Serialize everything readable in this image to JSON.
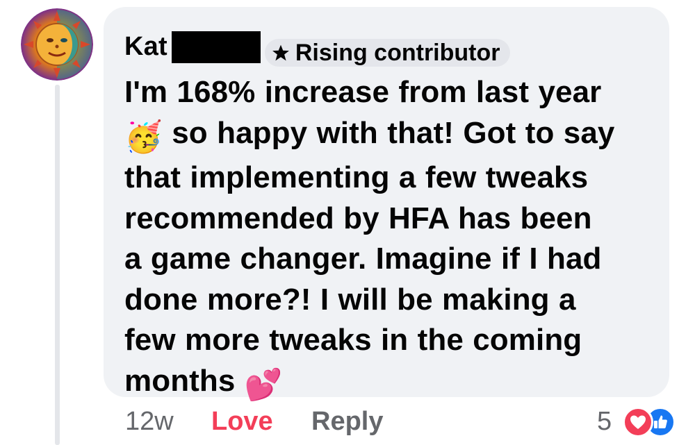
{
  "comment": {
    "author": "Kat",
    "author_redacted": true,
    "badge": {
      "label": "Rising contributor",
      "icon": "star-icon"
    },
    "lines": [
      "I'm 168% increase from last year",
      "so happy with that! Got to say",
      "that implementing a few tweaks",
      "recommended by HFA has been",
      "a game changer. Imagine if I had",
      "done more?! I will be making a",
      "few more tweaks in the coming",
      "months"
    ],
    "emojis": {
      "line2_prefix": "🥳",
      "line8_suffix": "💕"
    }
  },
  "footer": {
    "timestamp": "12w",
    "love_label": "Love",
    "reply_label": "Reply",
    "reaction_count": "5",
    "reaction_icons": [
      "heart-reaction-icon",
      "like-reaction-icon"
    ]
  },
  "colors": {
    "bubble_bg": "#f0f2f5",
    "love_red": "#f33e58",
    "muted_gray": "#65676b",
    "like_blue": "#1877f2"
  }
}
